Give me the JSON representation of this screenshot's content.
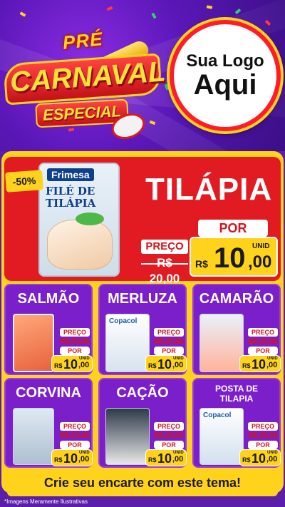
{
  "header": {
    "title_pre": "PRÉ",
    "title_main": "CARNAVAL",
    "title_sub": "ESPECIAL",
    "logo_line1": "Sua Logo",
    "logo_line2": "Aqui"
  },
  "hero": {
    "product_name": "TILÁPIA",
    "discount": "-50%",
    "package_brand": "Frimesa",
    "package_name": "FILÉ DE TILÁPIA",
    "price_label": "PREÇO",
    "old_price": "R$ 20,00",
    "new_label": "POR",
    "currency": "R$",
    "price_int": "10",
    "price_cents": ",00",
    "unit": "UNID"
  },
  "products": [
    {
      "name": "SALMÃO",
      "price_label": "PREÇO",
      "old_price": "R$ 20,00",
      "new_label": "POR",
      "currency": "R$",
      "price_int": "10",
      "price_cents": ",00",
      "unit": "UNID"
    },
    {
      "name": "MERLUZA",
      "package_brand": "Copacol",
      "price_label": "PREÇO",
      "old_price": "R$ 20,00",
      "new_label": "POR",
      "currency": "R$",
      "price_int": "10",
      "price_cents": ",00",
      "unit": "UNID"
    },
    {
      "name": "CAMARÃO",
      "price_label": "PREÇO",
      "old_price": "R$ 20,00",
      "new_label": "POR",
      "currency": "R$",
      "price_int": "10",
      "price_cents": ",00",
      "unit": "UNID"
    },
    {
      "name": "CORVINA",
      "price_label": "PREÇO",
      "old_price": "R$ 20,00",
      "new_label": "POR",
      "currency": "R$",
      "price_int": "10",
      "price_cents": ",00",
      "unit": "UNID"
    },
    {
      "name": "CAÇÃO",
      "price_label": "PREÇO",
      "old_price": "R$ 20,00",
      "new_label": "POR",
      "currency": "R$",
      "price_int": "10",
      "price_cents": ",00",
      "unit": "UNID"
    },
    {
      "name": "POSTA DE TILAPIA",
      "package_brand": "Copacol",
      "price_label": "PREÇO",
      "old_price": "R$ 20,00",
      "new_label": "POR",
      "currency": "R$",
      "price_int": "10",
      "price_cents": ",00",
      "unit": "UNID"
    }
  ],
  "footer": {
    "cta": "Crie seu encarte com este tema!",
    "disclaimer": "*Imagens Meramente Ilustrativas"
  },
  "colors": {
    "background_purple": "#5b1ea8",
    "card_purple": "#7a1fc9",
    "yellow": "#ffd21c",
    "red": "#e21b23",
    "white": "#ffffff"
  }
}
